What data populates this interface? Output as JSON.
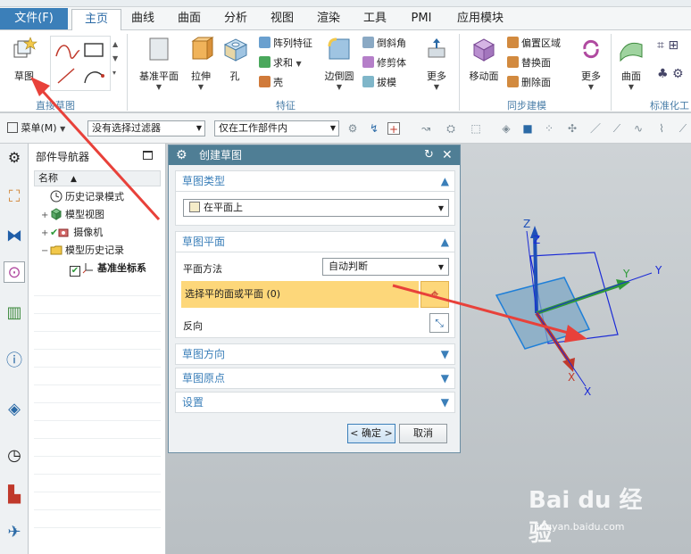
{
  "menu": {
    "file": "文件(F)",
    "tabs": [
      "主页",
      "曲线",
      "曲面",
      "分析",
      "视图",
      "渲染",
      "工具",
      "PMI",
      "应用模块"
    ]
  },
  "ribbon": {
    "sketch_label": "草图",
    "group_direct_sketch": "直接草图",
    "datum_plane": "基准平面",
    "extrude": "拉伸",
    "hole": "孔",
    "pattern_feature": "阵列特征",
    "unite": "求和",
    "shell": "壳",
    "edge_blend": "边倒圆",
    "chamfer": "倒斜角",
    "trim_body": "修剪体",
    "draft": "拔模",
    "more1": "更多",
    "group_feature": "特征",
    "move_face": "移动面",
    "offset_region": "偏置区域",
    "replace_face": "替换面",
    "delete_face": "删除面",
    "more2": "更多",
    "group_sync": "同步建模",
    "surface": "曲面",
    "group_standard": "标准化工"
  },
  "toolbar": {
    "menu_label": "菜单(M)",
    "filter": "没有选择过滤器",
    "scope": "仅在工作部件内"
  },
  "navigator": {
    "title": "部件导航器",
    "column": "名称",
    "items": [
      {
        "label": "历史记录模式"
      },
      {
        "label": "模型视图"
      },
      {
        "label": "摄像机"
      },
      {
        "label": "模型历史记录"
      },
      {
        "label": "基准坐标系"
      }
    ]
  },
  "dialog": {
    "title": "创建草图",
    "sketch_type": {
      "header": "草图类型",
      "value": "在平面上"
    },
    "sketch_plane": {
      "header": "草图平面",
      "method_label": "平面方法",
      "method_value": "自动判断",
      "select_label": "选择平的面或平面 (0)",
      "reverse_label": "反向"
    },
    "sketch_orientation": "草图方向",
    "sketch_origin": "草图原点",
    "settings": "设置",
    "ok": "< 确定 >",
    "cancel": "取消"
  },
  "triad": {
    "z1": "Z",
    "z2": "Z",
    "y1": "Y",
    "y2": "Y",
    "x1": "X",
    "x2": "X"
  },
  "watermark": {
    "brand": "Bai du 经验",
    "sub": "jingyan.baidu.com"
  },
  "colors": {
    "accent_blue": "#3b7fb9",
    "dialog_title": "#4f7e95",
    "highlight_row": "#fdd77a",
    "arrow_red": "#e8413a"
  }
}
